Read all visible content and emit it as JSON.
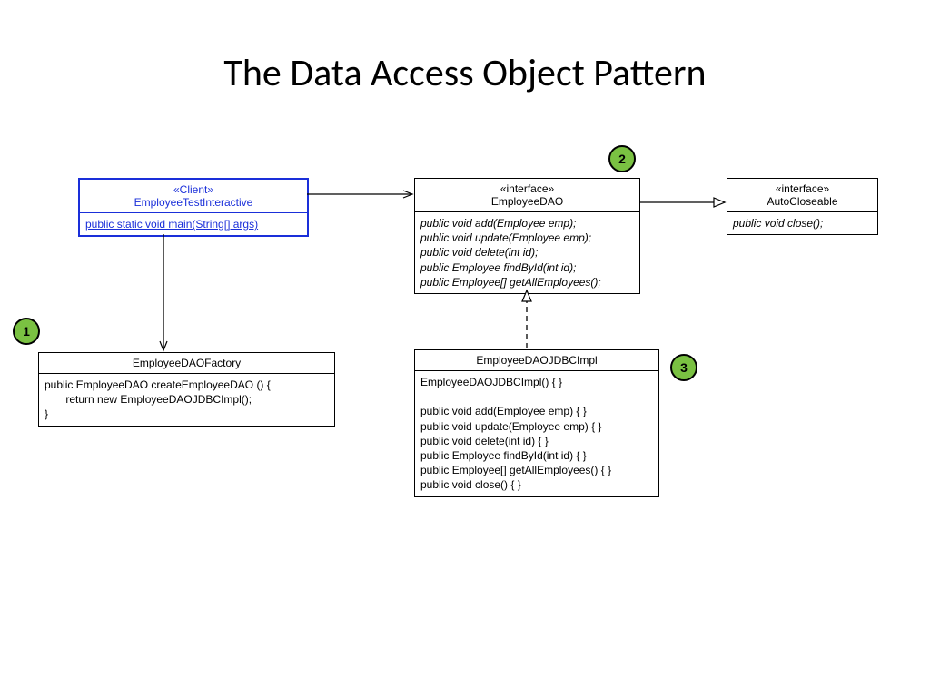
{
  "title": "The Data Access Object Pattern",
  "badges": {
    "b1": "1",
    "b2": "2",
    "b3": "3"
  },
  "client": {
    "stereotype": "«Client»",
    "name": "EmployeeTestInteractive",
    "body": "public static void main(String[] args)"
  },
  "dao": {
    "stereotype": "«interface»",
    "name": "EmployeeDAO",
    "body": "public void add(Employee emp);\npublic void update(Employee emp);\npublic void delete(int id);\npublic Employee findById(int id);\npublic Employee[] getAllEmployees();"
  },
  "auto": {
    "stereotype": "«interface»",
    "name": "AutoCloseable",
    "body": "public void close();"
  },
  "factory": {
    "name": "EmployeeDAOFactory",
    "body": "public EmployeeDAO createEmployeeDAO () {\n       return new EmployeeDAOJDBCImpl();\n}"
  },
  "impl": {
    "name": "EmployeeDAOJDBCImpl",
    "body": "EmployeeDAOJDBCImpl() { }\n\npublic void add(Employee emp) { }\npublic void update(Employee emp) { }\npublic void delete(int id) { }\npublic Employee findById(int id) { }\npublic Employee[] getAllEmployees() { }\npublic void close() { }"
  }
}
